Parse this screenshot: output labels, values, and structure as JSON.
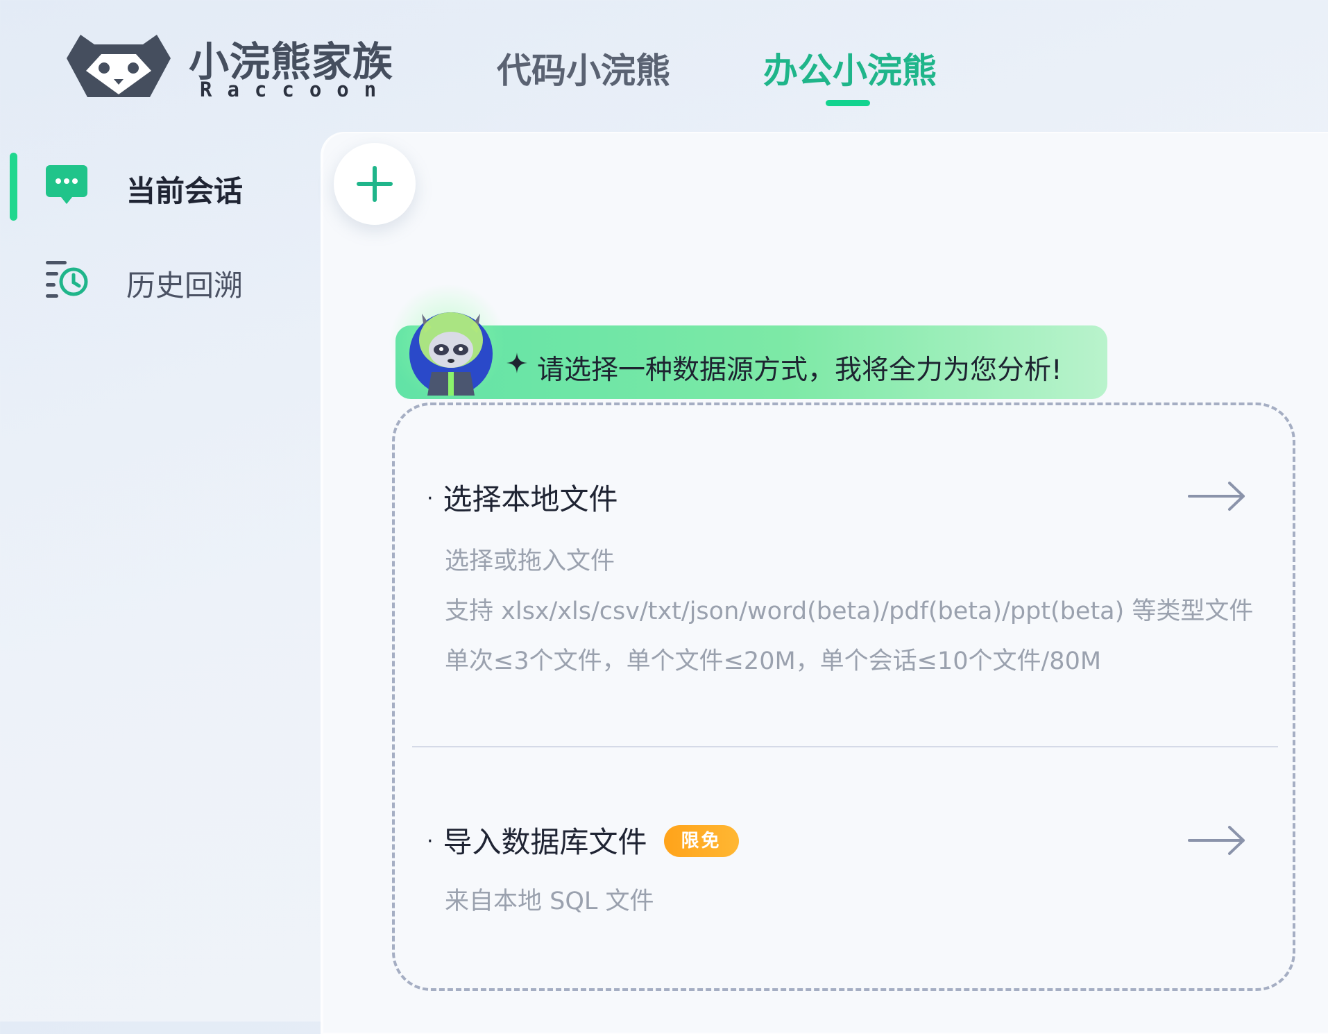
{
  "header": {
    "logo_title": "小浣熊家族",
    "logo_subtitle": "Raccoon",
    "tabs": [
      {
        "label": "代码小浣熊",
        "active": false
      },
      {
        "label": "办公小浣熊",
        "active": true
      }
    ]
  },
  "sidebar": {
    "items": [
      {
        "label": "当前会话",
        "icon": "chat-bubble-icon",
        "active": true
      },
      {
        "label": "历史回溯",
        "icon": "history-clock-icon",
        "active": false
      }
    ]
  },
  "main": {
    "new_chat_icon": "plus-icon",
    "greeting": "请选择一种数据源方式，我将全力为您分析!",
    "options": [
      {
        "title": "选择本地文件",
        "lines": [
          "选择或拖入文件",
          "支持 xlsx/xls/csv/txt/json/word(beta)/pdf(beta)/ppt(beta) 等类型文件",
          "单次≤3个文件，单个文件≤20M，单个会话≤10个文件/80M"
        ]
      },
      {
        "title": "导入数据库文件",
        "badge": "限免",
        "lines": [
          "来自本地 SQL 文件"
        ]
      }
    ]
  },
  "colors": {
    "accent": "#1fb58a",
    "accent_bright": "#20d78e",
    "badge": "#ffa31a",
    "muted_text": "#9aa1ae"
  }
}
